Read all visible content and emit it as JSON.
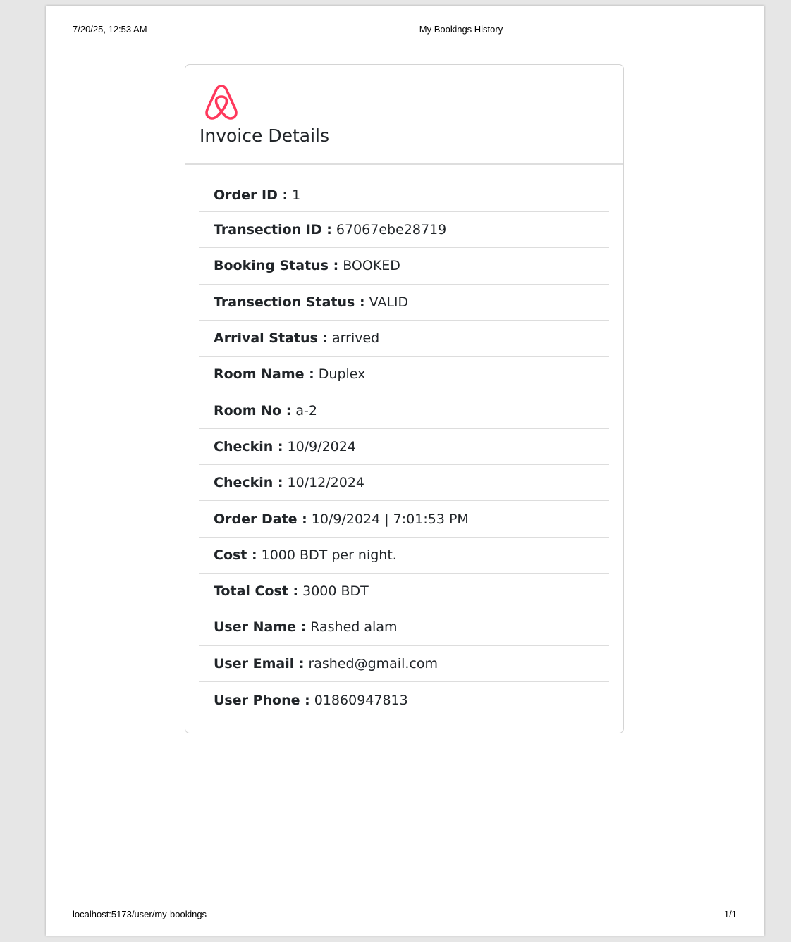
{
  "print_header": {
    "date": "7/20/25, 12:53 AM",
    "title": "My Bookings History"
  },
  "print_footer": {
    "url": "localhost:5173/user/my-bookings",
    "page": "1/1"
  },
  "card": {
    "logo_icon": "airbnb-logo-icon",
    "brand_color": "#ff385c",
    "title": "Invoice Details"
  },
  "details": [
    {
      "label": "Order ID :",
      "value": "1"
    },
    {
      "label": "Transection ID :",
      "value": "67067ebe28719"
    },
    {
      "label": "Booking Status :",
      "value": "BOOKED"
    },
    {
      "label": "Transection Status :",
      "value": "VALID"
    },
    {
      "label": "Arrival Status :",
      "value": "arrived"
    },
    {
      "label": "Room Name :",
      "value": "Duplex"
    },
    {
      "label": "Room No :",
      "value": "a-2"
    },
    {
      "label": "Checkin :",
      "value": "10/9/2024"
    },
    {
      "label": "Checkin :",
      "value": "10/12/2024"
    },
    {
      "label": "Order Date :",
      "value": "10/9/2024 | 7:01:53 PM"
    },
    {
      "label": "Cost :",
      "value": "1000 BDT per night."
    },
    {
      "label": "Total Cost :",
      "value": "3000 BDT"
    },
    {
      "label": "User Name :",
      "value": "Rashed alam"
    },
    {
      "label": "User Email :",
      "value": "rashed@gmail.com"
    },
    {
      "label": "User Phone :",
      "value": "01860947813"
    }
  ]
}
